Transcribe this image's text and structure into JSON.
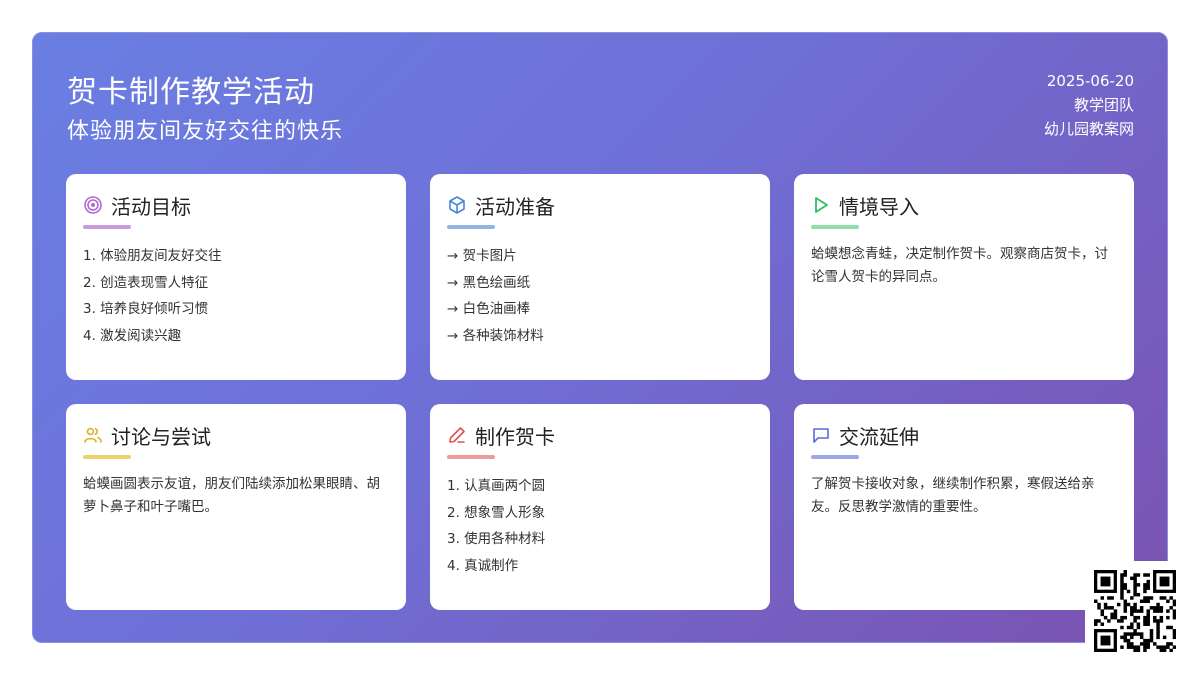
{
  "header": {
    "title": "贺卡制作教学活动",
    "subtitle": "体验朋友间友好交往的快乐",
    "date": "2025-06-20",
    "team": "教学团队",
    "source": "幼儿园教案网"
  },
  "cards": {
    "goals": {
      "title": "活动目标",
      "icon": "target-icon",
      "accent": "#c99be0",
      "items": [
        "1. 体验朋友间友好交往",
        "2. 创造表现雪人特征",
        "3. 培养良好倾听习惯",
        "4. 激发阅读兴趣"
      ]
    },
    "prep": {
      "title": "活动准备",
      "icon": "box-icon",
      "accent": "#8fb6e6",
      "items": [
        "→ 贺卡图片",
        "→ 黑色绘画纸",
        "→ 白色油画棒",
        "→ 各种装饰材料"
      ]
    },
    "intro": {
      "title": "情境导入",
      "icon": "play-icon",
      "accent": "#8fe0a6",
      "text": "蛤蟆想念青蛙，决定制作贺卡。观察商店贺卡，讨论雪人贺卡的异同点。"
    },
    "discuss": {
      "title": "讨论与尝试",
      "icon": "users-icon",
      "accent": "#ecd46a",
      "text": "蛤蟆画圆表示友谊，朋友们陆续添加松果眼睛、胡萝卜鼻子和叶子嘴巴。"
    },
    "make": {
      "title": "制作贺卡",
      "icon": "pencil-icon",
      "accent": "#ec9a9a",
      "items": [
        "1. 认真画两个圆",
        "2. 想象雪人形象",
        "3. 使用各种材料",
        "4. 真诚制作"
      ]
    },
    "share": {
      "title": "交流延伸",
      "icon": "chat-icon",
      "accent": "#9aa6e6",
      "text": "了解贺卡接收对象，继续制作积累，寒假送给亲友。反思教学激情的重要性。"
    }
  }
}
